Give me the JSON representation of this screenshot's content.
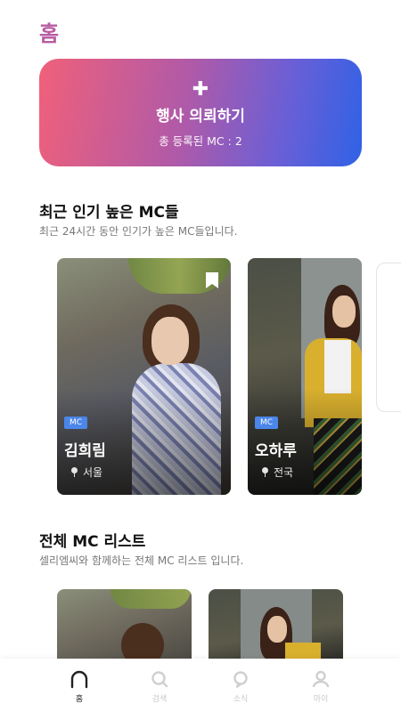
{
  "header": {
    "title": "홈"
  },
  "request_card": {
    "icon": "plus-icon",
    "title": "행사 의뢰하기",
    "subtitle": "총 등록된 MC : 2"
  },
  "popular": {
    "title": "최근 인기 높은 MC들",
    "subtitle": "최근 24시간 동안 인기가 높은 MC들입니다.",
    "cards": [
      {
        "badge": "MC",
        "name": "김희림",
        "location": "서울",
        "bookmarked": true
      },
      {
        "badge": "MC",
        "name": "오하루",
        "location": "전국",
        "bookmarked": false
      }
    ]
  },
  "all_list": {
    "title": "전체 MC 리스트",
    "subtitle": "셀리엠씨와 함께하는 전체 MC 리스트 입니다."
  },
  "tabbar": {
    "items": [
      {
        "label": "홈",
        "icon": "home-icon",
        "active": true
      },
      {
        "label": "검색",
        "icon": "search-icon",
        "active": false
      },
      {
        "label": "소식",
        "icon": "news-icon",
        "active": false
      },
      {
        "label": "마이",
        "icon": "profile-icon",
        "active": false
      }
    ]
  },
  "colors": {
    "title_accent": "#b85aa2",
    "gradient_start": "#f0607a",
    "gradient_end": "#2f62e6",
    "badge": "#4b86e8"
  }
}
